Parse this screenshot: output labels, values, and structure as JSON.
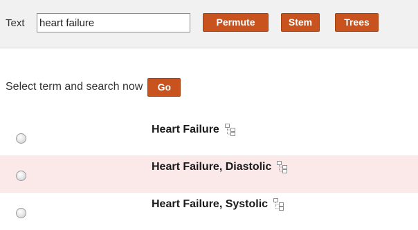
{
  "search": {
    "label": "Text",
    "value": "heart failure"
  },
  "buttons": {
    "permute": "Permute",
    "stem": "Stem",
    "trees": "Trees",
    "go": "Go"
  },
  "prompt": {
    "label": "Select term and search now"
  },
  "results": [
    {
      "term": "Heart Failure",
      "selected": false,
      "highlighted": false
    },
    {
      "term": "Heart Failure, Diastolic",
      "selected": false,
      "highlighted": true
    },
    {
      "term": "Heart Failure, Systolic",
      "selected": false,
      "highlighted": false
    }
  ],
  "colors": {
    "button": "#c8531e",
    "highlight_row": "#fbe9e9",
    "toolbar_bg": "#f1f1f1"
  },
  "icons": {
    "tree": "tree-hierarchy-icon"
  }
}
